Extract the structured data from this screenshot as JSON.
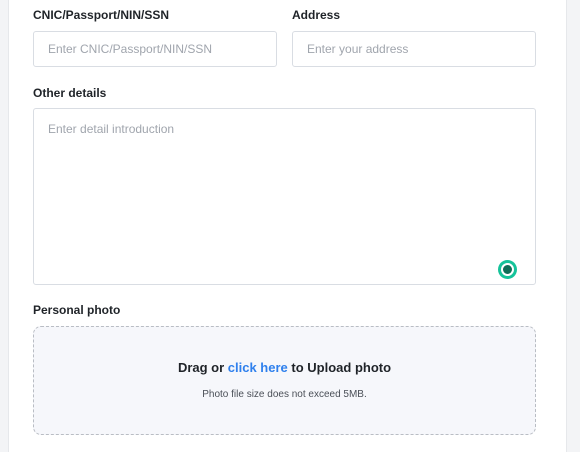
{
  "form": {
    "cnic": {
      "label": "CNIC/Passport/NIN/SSN",
      "placeholder": "Enter CNIC/Passport/NIN/SSN",
      "value": ""
    },
    "address": {
      "label": "Address",
      "placeholder": "Enter your address",
      "value": ""
    },
    "other_details": {
      "label": "Other details",
      "placeholder": "Enter detail introduction",
      "value": ""
    },
    "personal_photo": {
      "label": "Personal photo",
      "upload_prefix": "Drag or ",
      "upload_link": "click here",
      "upload_suffix": " to Upload photo",
      "hint": "Photo file size does not exceed 5MB."
    }
  },
  "assistant_icon": {
    "name": "grammarly-icon",
    "color": "#15c39a"
  },
  "colors": {
    "link": "#2f80ed",
    "border": "#d9dde3",
    "dropzone_bg": "#f6f7fb"
  }
}
